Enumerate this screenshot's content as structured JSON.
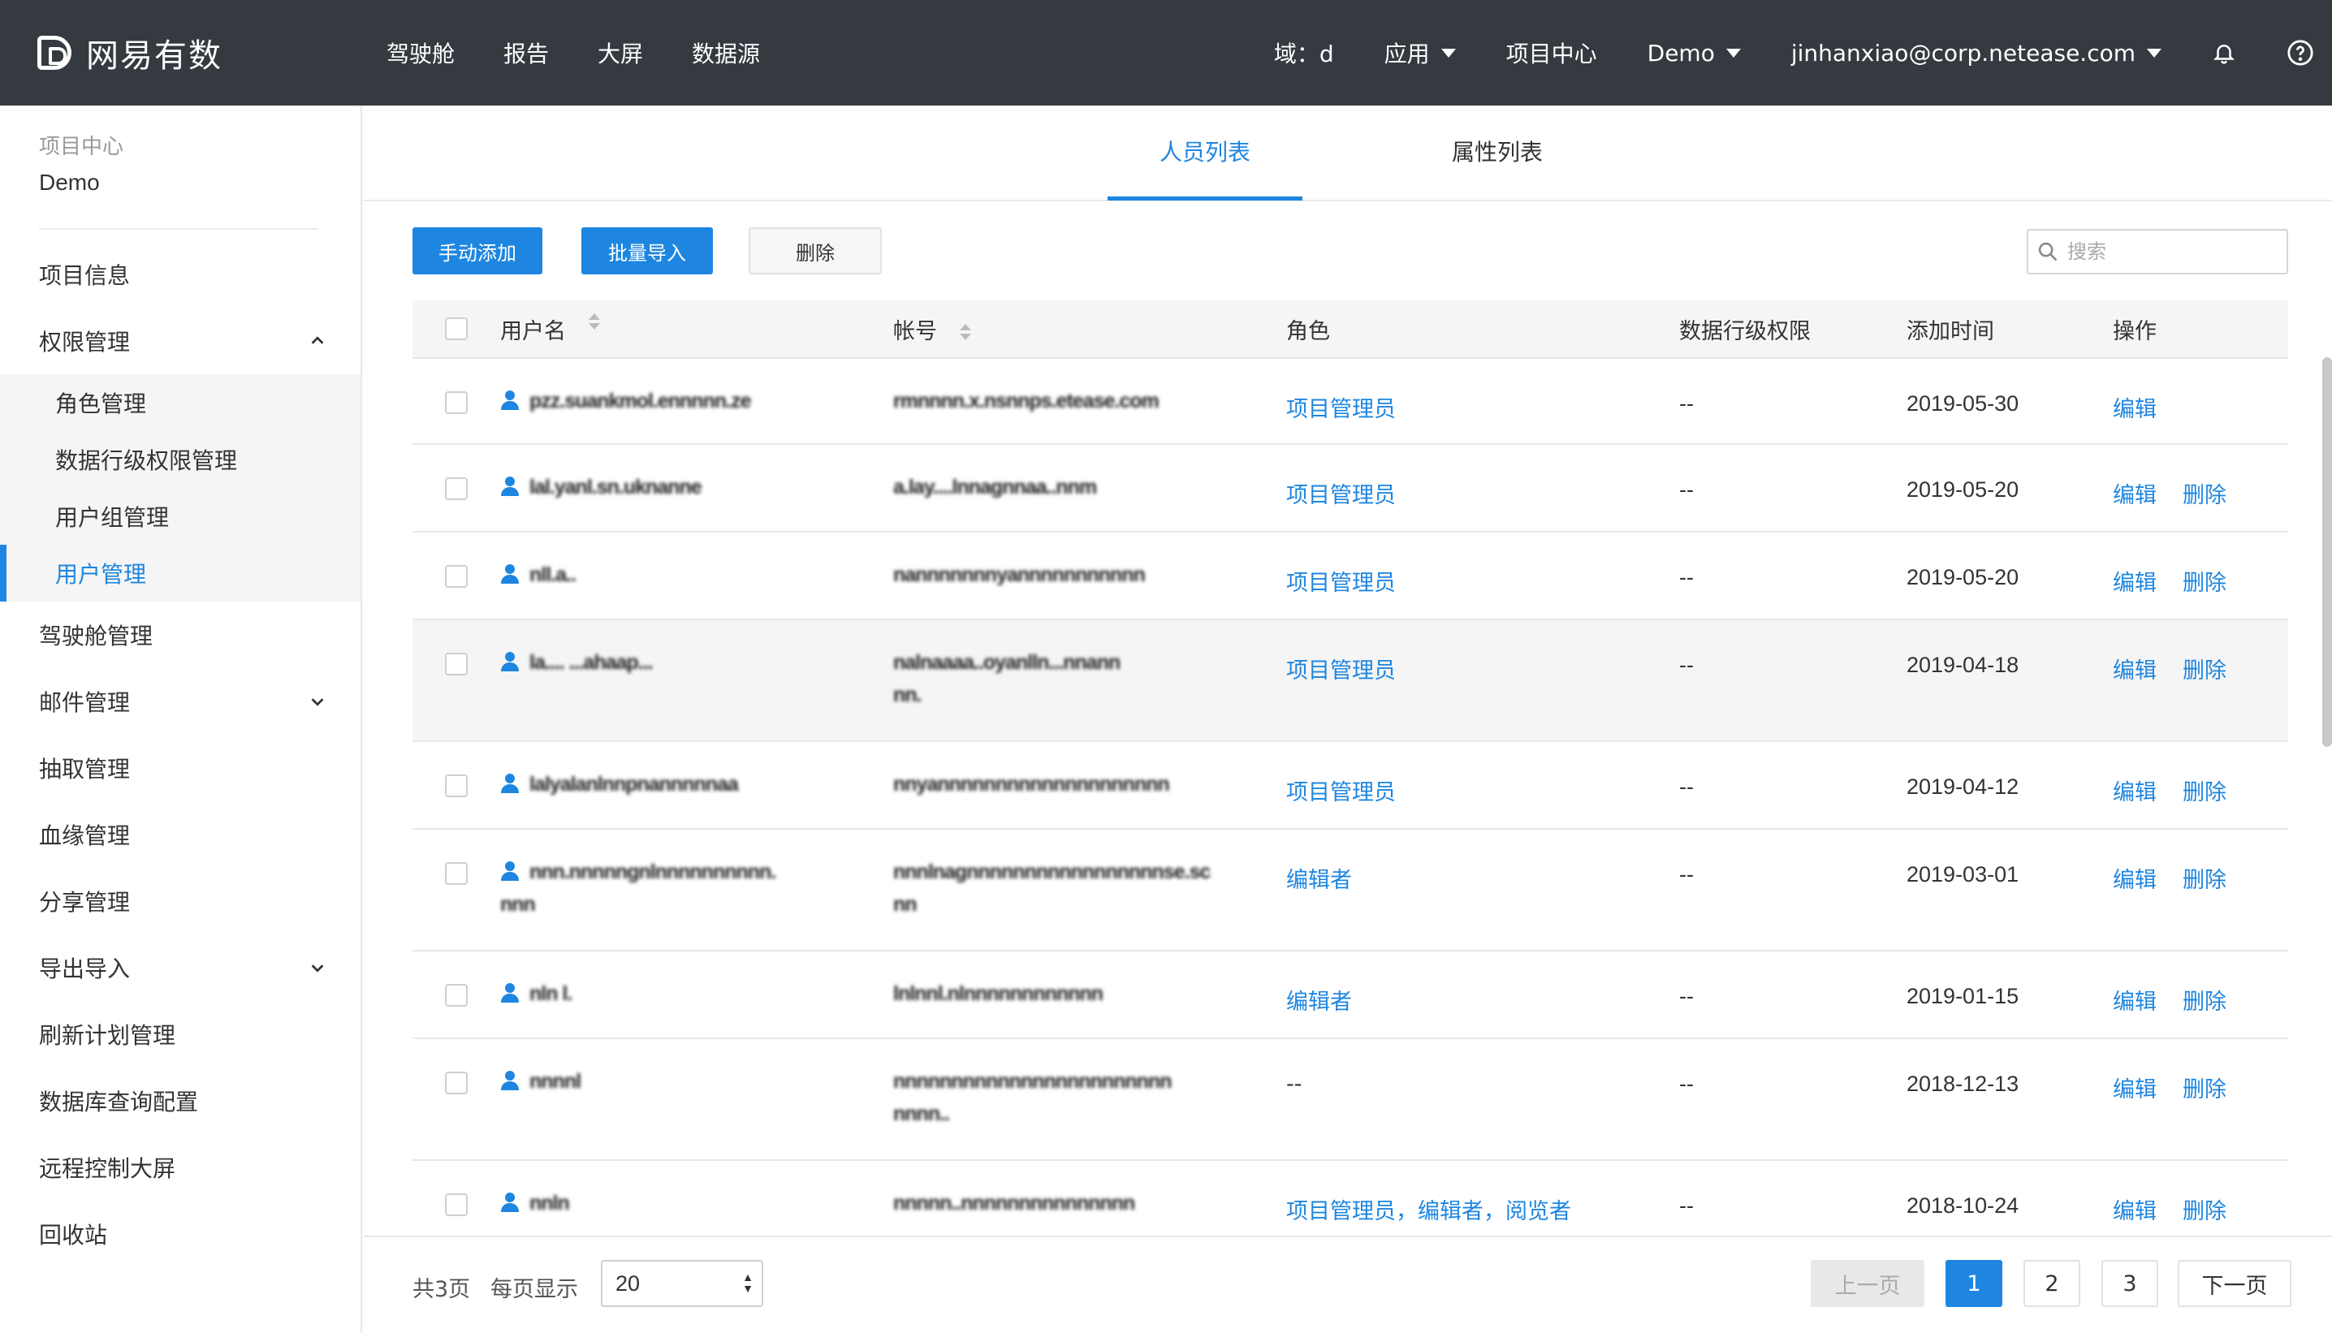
{
  "app": {
    "brand": "网易有数"
  },
  "topnav": [
    "驾驶舱",
    "报告",
    "大屏",
    "数据源"
  ],
  "topright": {
    "domain": "域：d",
    "apps": "应用",
    "project_center": "项目中心",
    "project": "Demo",
    "user": "jinhanxiao@corp.netease.com"
  },
  "sidebar": {
    "crumb": "项目中心",
    "project": "Demo",
    "items": {
      "project_info": "项目信息",
      "permission": "权限管理",
      "sub": [
        "角色管理",
        "数据行级权限管理",
        "用户组管理",
        "用户管理"
      ],
      "cockpit": "驾驶舱管理",
      "mail": "邮件管理",
      "extract": "抽取管理",
      "lineage": "血缘管理",
      "share": "分享管理",
      "io": "导出导入",
      "refresh": "刷新计划管理",
      "dbquery": "数据库查询配置",
      "remote": "远程控制大屏",
      "trash": "回收站"
    }
  },
  "tabs": [
    "人员列表",
    "属性列表"
  ],
  "toolbar": {
    "add": "手动添加",
    "import": "批量导入",
    "delete": "删除",
    "search_placeholder": "搜索"
  },
  "table": {
    "headers": {
      "username": "用户名",
      "account": "帐号",
      "role": "角色",
      "data": "数据行级权限",
      "time": "添加时间",
      "ops": "操作"
    },
    "edit": "编辑",
    "remove": "删除",
    "rows": [
      {
        "user": "pzz.suankmol.ennnnn.ze",
        "acct": "rmnnnn.x.nsnnps.etease.com",
        "role": "项目管理员",
        "data": "--",
        "time": "2019-05-30",
        "del": false
      },
      {
        "user": "lal.yanl.sn.uknanne",
        "acct": "a.lay....lnnagnnaa..nnm",
        "role": "项目管理员",
        "data": "--",
        "time": "2019-05-20",
        "del": true
      },
      {
        "user": "nll.a..",
        "acct": "nannnnnnnyannnnnnnnnnn",
        "role": "项目管理员",
        "data": "--",
        "time": "2019-05-20",
        "del": true
      },
      {
        "user": "la.... ...ahaap...",
        "acct": "nalnaaaa..oyanlln...nnann",
        "acct2": "nn.",
        "role": "项目管理员",
        "data": "--",
        "time": "2019-04-18",
        "del": true
      },
      {
        "user": "lalyalanlnnpnannnnnaa",
        "acct": "nnyannnnnnnnnnnnnnnnnnnn",
        "role": "项目管理员",
        "data": "--",
        "time": "2019-04-12",
        "del": true
      },
      {
        "user": "nnn.nnnnngnlnnnnnnnnnn.",
        "user2": "nnn",
        "acct": "nnnlnagnnnnnnnnnnnnnnnnnse.sc",
        "acct2": "nn",
        "role": "编辑者",
        "data": "--",
        "time": "2019-03-01",
        "del": true
      },
      {
        "user": "nln l.",
        "acct": "lnlnnl.nlnnnnnnnnnnnn",
        "role": "编辑者",
        "data": "--",
        "time": "2019-01-15",
        "del": true
      },
      {
        "user": "nnnnl",
        "acct": "nnnnnnnnnnnnnnnnnnnnnnnn",
        "acct2": "nnnn..",
        "role": "--",
        "data": "--",
        "time": "2018-12-13",
        "del": true
      },
      {
        "user": "nnln",
        "acct": "nnnnn..nnnnnnnnnnnnnnn",
        "role": "项目管理员，编辑者，阅览者",
        "data": "--",
        "time": "2018-10-24",
        "del": true
      }
    ]
  },
  "pagination": {
    "total": "共3页",
    "per_page_label": "每页显示",
    "per_page": "20",
    "prev": "上一页",
    "pages": [
      "1",
      "2",
      "3"
    ],
    "next": "下一页"
  },
  "colors": {
    "accent": "#1e86e0",
    "topbar": "#343a40"
  }
}
